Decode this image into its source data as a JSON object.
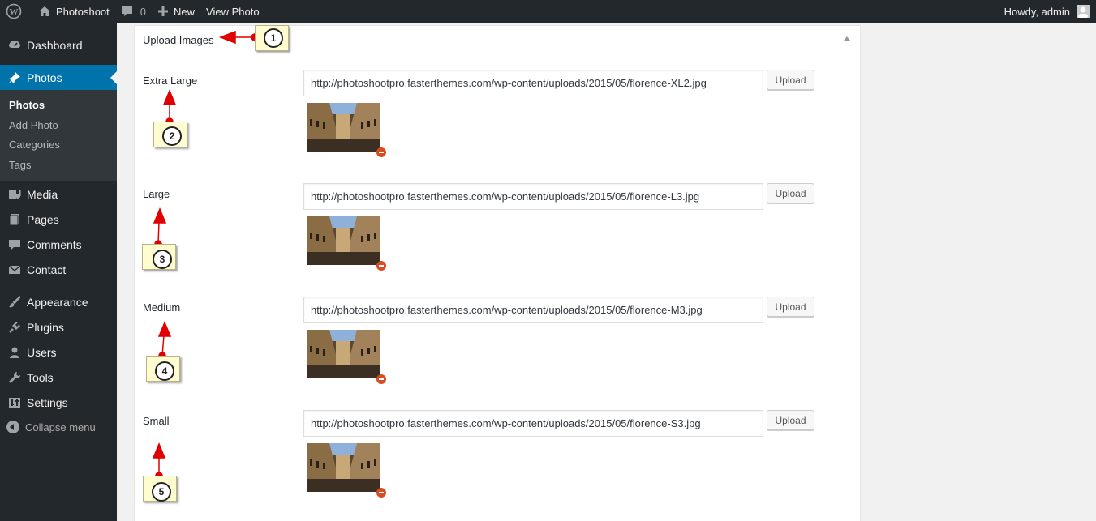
{
  "adminbar": {
    "site_name": "Photoshoot",
    "comment_count": "0",
    "new_label": "New",
    "view_label": "View Photo",
    "howdy": "Howdy, admin"
  },
  "sidebar": {
    "items": [
      {
        "label": "Dashboard",
        "icon": "dashboard-icon"
      },
      {
        "label": "Photos",
        "icon": "pin-icon"
      },
      {
        "label": "Media",
        "icon": "media-icon"
      },
      {
        "label": "Pages",
        "icon": "pages-icon"
      },
      {
        "label": "Comments",
        "icon": "comments-icon"
      },
      {
        "label": "Contact",
        "icon": "mail-icon"
      },
      {
        "label": "Appearance",
        "icon": "paintbrush-icon"
      },
      {
        "label": "Plugins",
        "icon": "plugin-icon"
      },
      {
        "label": "Users",
        "icon": "users-icon"
      },
      {
        "label": "Tools",
        "icon": "wrench-icon"
      },
      {
        "label": "Settings",
        "icon": "settings-icon"
      }
    ],
    "submenu": [
      "Photos",
      "Add Photo",
      "Categories",
      "Tags"
    ],
    "collapse": "Collapse menu"
  },
  "postbox": {
    "title": "Upload Images",
    "fields": [
      {
        "label": "Extra Large",
        "url": "http://photoshootpro.fasterthemes.com/wp-content/uploads/2015/05/florence-XL2.jpg",
        "button": "Upload"
      },
      {
        "label": "Large",
        "url": "http://photoshootpro.fasterthemes.com/wp-content/uploads/2015/05/florence-L3.jpg",
        "button": "Upload"
      },
      {
        "label": "Medium",
        "url": "http://photoshootpro.fasterthemes.com/wp-content/uploads/2015/05/florence-M3.jpg",
        "button": "Upload"
      },
      {
        "label": "Small",
        "url": "http://photoshootpro.fasterthemes.com/wp-content/uploads/2015/05/florence-S3.jpg",
        "button": "Upload"
      }
    ]
  },
  "callouts": [
    "1",
    "2",
    "3",
    "4",
    "5"
  ],
  "colors": {
    "accent": "#0073aa",
    "adminbar": "#23282d",
    "annotation_arrow": "#e00000",
    "callout_bg": "#fffcd0"
  }
}
